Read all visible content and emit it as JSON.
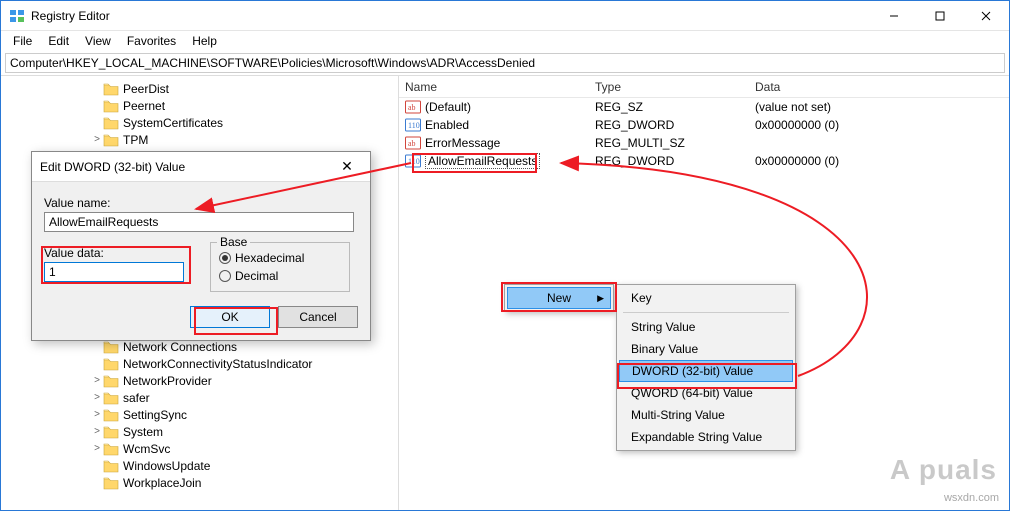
{
  "window": {
    "title": "Registry Editor",
    "min_tip": "Minimize",
    "max_tip": "Maximize",
    "close_tip": "Close"
  },
  "menubar": [
    "File",
    "Edit",
    "View",
    "Favorites",
    "Help"
  ],
  "address": "Computer\\HKEY_LOCAL_MACHINE\\SOFTWARE\\Policies\\Microsoft\\Windows\\ADR\\AccessDenied",
  "tree": [
    {
      "exp": "",
      "label": "PeerDist"
    },
    {
      "exp": "",
      "label": "Peernet"
    },
    {
      "exp": "",
      "label": "SystemCertificates"
    },
    {
      "exp": ">",
      "label": "TPM"
    },
    {
      "exp": "",
      "label": "Network Connections"
    },
    {
      "exp": "",
      "label": "NetworkConnectivityStatusIndicator"
    },
    {
      "exp": ">",
      "label": "NetworkProvider"
    },
    {
      "exp": ">",
      "label": "safer"
    },
    {
      "exp": ">",
      "label": "SettingSync"
    },
    {
      "exp": ">",
      "label": "System"
    },
    {
      "exp": ">",
      "label": "WcmSvc"
    },
    {
      "exp": "",
      "label": "WindowsUpdate"
    },
    {
      "exp": "",
      "label": "WorkplaceJoin"
    }
  ],
  "columns": {
    "name": "Name",
    "type": "Type",
    "data": "Data"
  },
  "rows": [
    {
      "icon": "sz",
      "name": "(Default)",
      "type": "REG_SZ",
      "data": "(value not set)"
    },
    {
      "icon": "dw",
      "name": "Enabled",
      "type": "REG_DWORD",
      "data": "0x00000000 (0)"
    },
    {
      "icon": "sz",
      "name": "ErrorMessage",
      "type": "REG_MULTI_SZ",
      "data": ""
    },
    {
      "icon": "dw",
      "name": "AllowEmailRequests",
      "type": "REG_DWORD",
      "data": "0x00000000 (0)",
      "selected": true
    }
  ],
  "dialog": {
    "title": "Edit DWORD (32-bit) Value",
    "value_name_label": "Value name:",
    "value_name": "AllowEmailRequests",
    "value_data_label": "Value data:",
    "value_data": "1",
    "base_label": "Base",
    "hex_label": "Hexadecimal",
    "dec_label": "Decimal",
    "ok": "OK",
    "cancel": "Cancel"
  },
  "ctx": {
    "new": "New",
    "items": [
      "Key",
      "String Value",
      "Binary Value",
      "DWORD (32-bit) Value",
      "QWORD (64-bit) Value",
      "Multi-String Value",
      "Expandable String Value"
    ]
  },
  "watermark": {
    "brand": "A  puals",
    "site": "wsxdn.com"
  }
}
